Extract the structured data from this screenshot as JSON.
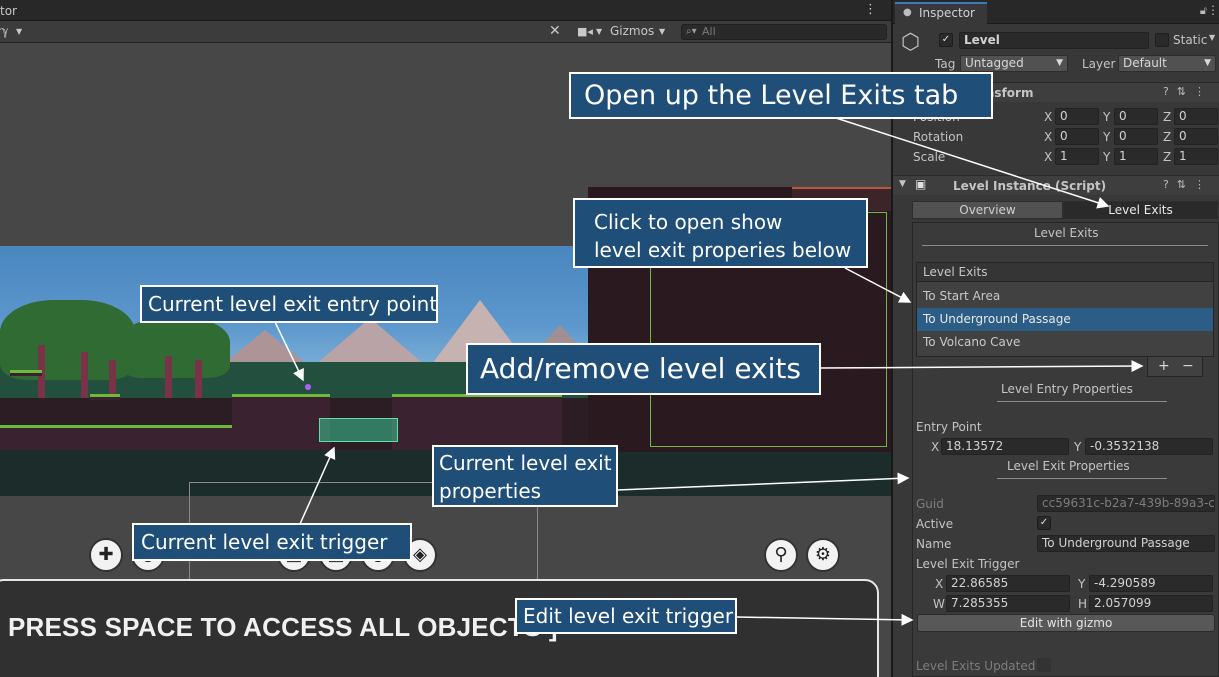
{
  "scene": {
    "tab_title": "tor",
    "menu_dots": "⋮",
    "toolbar": {
      "tools_icon": "tools-icon",
      "camera_icon": "video-camera-icon",
      "gizmos_label": "Gizmos",
      "search_placeholder": "All"
    },
    "press_space_text": "PRESS SPACE TO ACCESS ALL OBJECTS ]",
    "overlay_buttons": [
      "puzzle-piece-icon",
      "circle-icon",
      "grid-icon",
      "layers-icon",
      "zoom-icon",
      "settings-icon"
    ]
  },
  "inspector": {
    "tab_label": "Inspector",
    "object": {
      "name": "Level",
      "active": true,
      "static_label": "Static",
      "tag_label": "Tag",
      "tag_value": "Untagged",
      "layer_label": "Layer",
      "layer_value": "Default"
    },
    "transform": {
      "header_label": "Transform",
      "position_label": "Position",
      "rotation_label": "Rotation",
      "scale_label": "Scale",
      "x_label": "X",
      "y_label": "Y",
      "z_label": "Z",
      "position": [
        "0",
        "0",
        "0"
      ],
      "rotation": [
        "0",
        "0",
        "0"
      ],
      "scale": [
        "1",
        "1",
        "1"
      ]
    },
    "script": {
      "header_label": "Level Instance (Script)",
      "tab_overview": "Overview",
      "tab_level_exits": "Level Exits",
      "section_title": "Level Exits",
      "list_header": "Level Exits",
      "exits": [
        "To Start Area",
        "To Underground Passage",
        "To Volcano Cave"
      ],
      "selected_exit": "To Underground Passage",
      "add_label": "+",
      "remove_label": "−",
      "entry_props_title": "Level Entry Properties",
      "entry_point_label": "Entry Point",
      "entry_x_label": "X",
      "entry_x": "18.13572",
      "entry_y_label": "Y",
      "entry_y": "-0.3532138",
      "exit_props_title": "Level Exit Properties",
      "guid_label": "Guid",
      "guid_value": "cc59631c-b2a7-439b-89a3-c",
      "active_label": "Active",
      "active_value": true,
      "name_label": "Name",
      "name_value": "To Underground Passage",
      "trigger_label": "Level Exit Trigger",
      "trigger_x_label": "X",
      "trigger_x": "22.86585",
      "trigger_y_label": "Y",
      "trigger_y": "-4.290589",
      "trigger_w_label": "W",
      "trigger_w": "7.285355",
      "trigger_h_label": "H",
      "trigger_h": "2.057099",
      "edit_gizmo_label": "Edit with gizmo",
      "updated_label": "Level Exits Updated"
    }
  },
  "callouts": {
    "open_tab": "Open up the Level Exits tab",
    "click_open_line1": "Click to open show",
    "click_open_line2": "level exit properies below",
    "entry_point": "Current level exit entry point",
    "add_remove": "Add/remove level exits",
    "exit_props_line1": "Current level exit",
    "exit_props_line2": "properties",
    "exit_trigger": "Current level exit trigger",
    "edit_trigger": "Edit level exit trigger"
  },
  "colors": {
    "callout_bg": "#1f4e79",
    "selection": "#2c5d87",
    "trigger_fill": "#3cc896"
  }
}
